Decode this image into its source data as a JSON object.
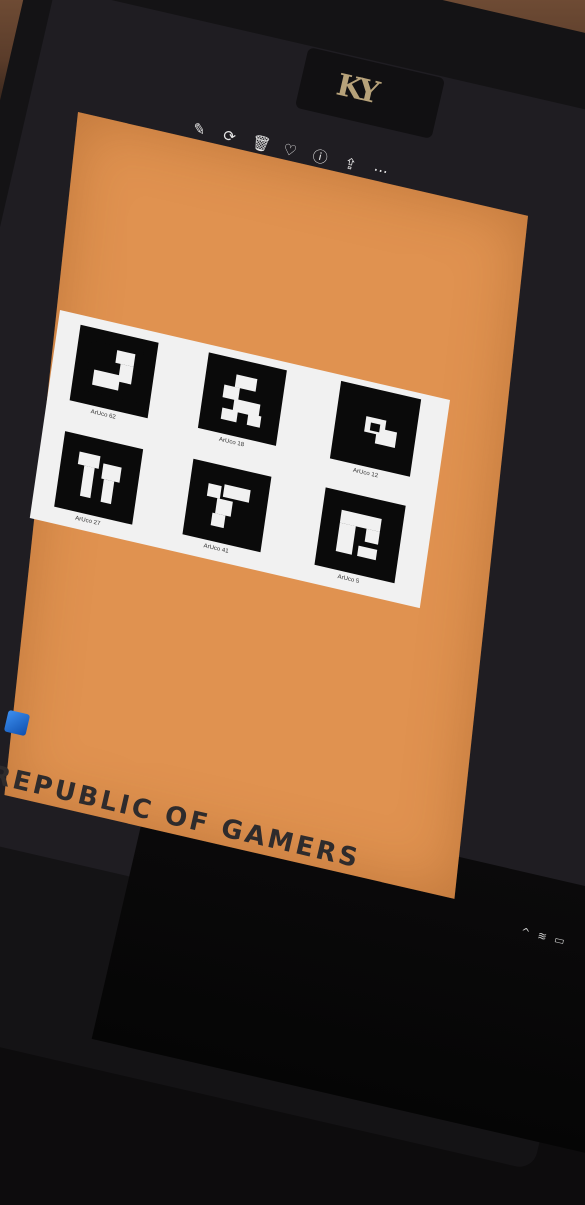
{
  "viewer": {
    "toolbar": [
      {
        "name": "edit-icon",
        "glyph": "✎"
      },
      {
        "name": "rotate-icon",
        "glyph": "⟳"
      },
      {
        "name": "delete-icon",
        "glyph": "🗑"
      },
      {
        "name": "favorite-icon",
        "glyph": "♡"
      },
      {
        "name": "info-icon",
        "glyph": "ⓘ"
      },
      {
        "name": "share-icon",
        "glyph": "⇪"
      },
      {
        "name": "more-icon",
        "glyph": "···"
      }
    ]
  },
  "markers": [
    {
      "label": "ArUco 62"
    },
    {
      "label": "ArUco 18"
    },
    {
      "label": "ArUco 12"
    },
    {
      "label": "ArUco 27"
    },
    {
      "label": "ArUco 41"
    },
    {
      "label": "ArUco 5"
    }
  ],
  "laptop": {
    "bezel_logo": "KY",
    "keyboard_text": "REPUBLIC OF GAMERS"
  },
  "colors": {
    "photo_background": "#e09250",
    "marker_black": "#0a0a0a",
    "sheet_white": "#f1f1f1"
  }
}
